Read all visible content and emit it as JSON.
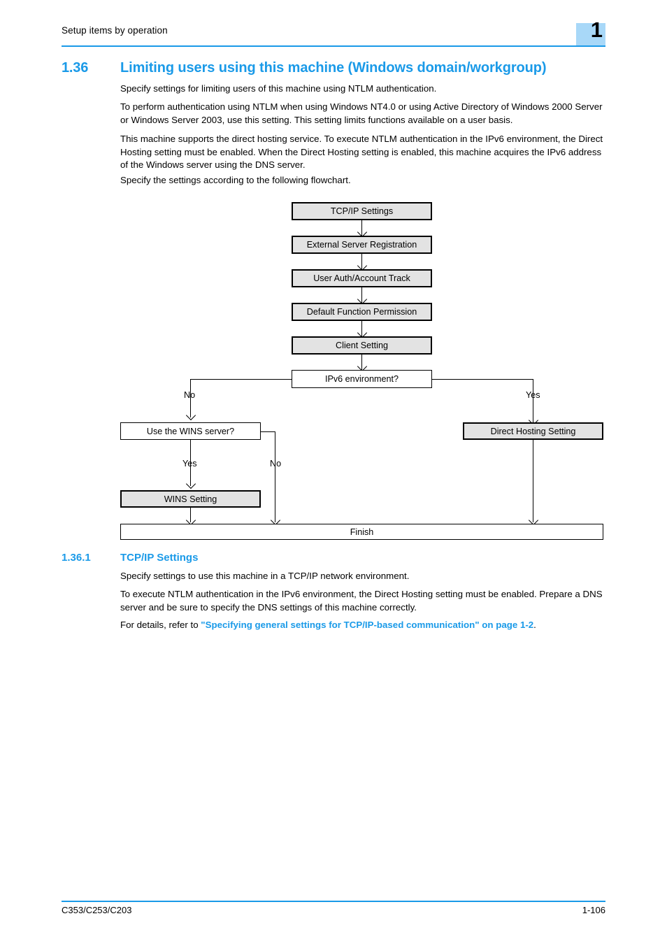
{
  "header": {
    "title": "Setup items by operation",
    "chapter_number": "1",
    "badge_color": "#a8d8f8",
    "rule_color": "#1a9ae8"
  },
  "section": {
    "number": "1.36",
    "title": "Limiting users using this machine (Windows domain/workgroup)",
    "heading_color": "#1a9ae8"
  },
  "paragraphs": {
    "p1": "Specify settings for limiting users of this machine using NTLM authentication.",
    "p2": "To perform authentication using NTLM when using Windows NT4.0 or using Active Directory of Windows 2000 Server or Windows Server 2003, use this setting. This setting limits functions available on a user basis.",
    "p3": "This machine supports the direct hosting service. To execute NTLM authentication in the IPv6 environment, the Direct Hosting setting must be enabled. When the Direct Hosting setting is enabled, this machine acquires the IPv6 address of the Windows server using the DNS server.",
    "p4": "Specify the settings according to the following flowchart."
  },
  "flowchart": {
    "nodes": [
      {
        "id": "tcpip",
        "label": "TCP/IP Settings",
        "type": "process"
      },
      {
        "id": "extserver",
        "label": "External Server Registration",
        "type": "process"
      },
      {
        "id": "userauth",
        "label": "User Auth/Account Track",
        "type": "process"
      },
      {
        "id": "defaultfunc",
        "label": "Default Function Permission",
        "type": "process"
      },
      {
        "id": "client",
        "label": "Client Setting",
        "type": "process"
      },
      {
        "id": "ipv6",
        "label": "IPv6 environment?",
        "type": "decision"
      },
      {
        "id": "wins_q",
        "label": "Use the WINS server?",
        "type": "decision"
      },
      {
        "id": "directhosting",
        "label": "Direct Hosting Setting",
        "type": "process"
      },
      {
        "id": "wins_set",
        "label": "WINS Setting",
        "type": "process"
      },
      {
        "id": "finish",
        "label": "Finish",
        "type": "terminal"
      }
    ],
    "branch_labels": {
      "ipv6_no": "No",
      "ipv6_yes": "Yes",
      "wins_yes": "Yes",
      "wins_no": "No"
    }
  },
  "subsection": {
    "number": "1.36.1",
    "title": "TCP/IP Settings",
    "p1": "Specify settings to use this machine in a TCP/IP network environment.",
    "p2": "To execute NTLM authentication in the IPv6 environment, the Direct Hosting setting must be enabled. Prepare a DNS server and be sure to specify the DNS settings of this machine correctly.",
    "p3_prefix": "For details, refer to ",
    "p3_link": "\"Specifying general settings for TCP/IP-based communication\" on page 1-2",
    "p3_suffix": "."
  },
  "footer": {
    "model": "C353/C253/C203",
    "page": "1-106"
  }
}
